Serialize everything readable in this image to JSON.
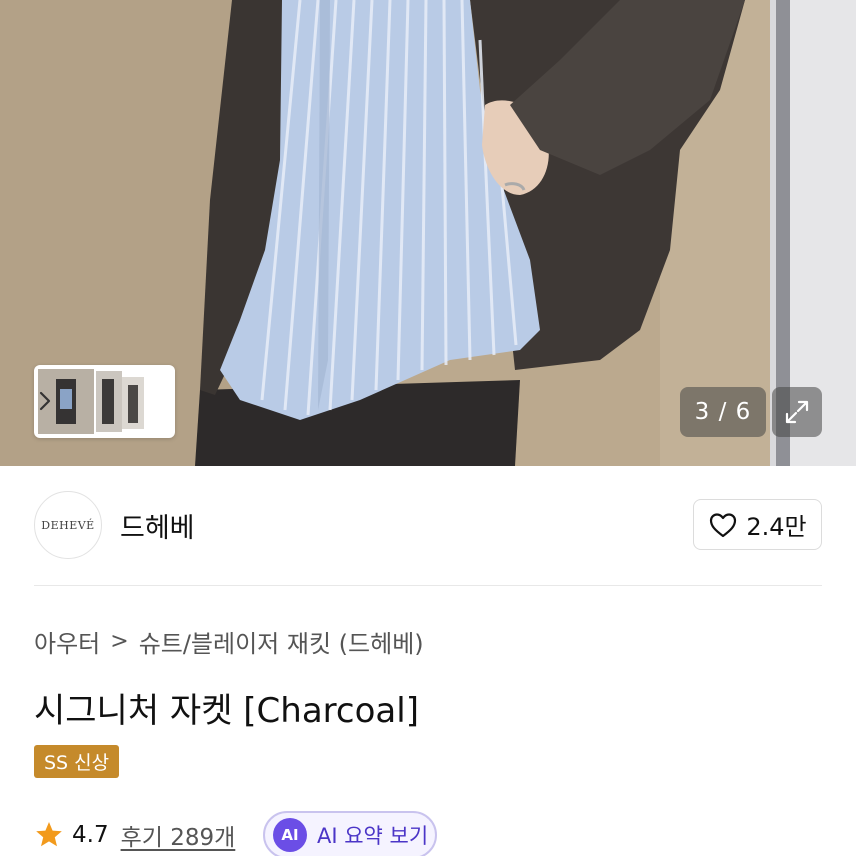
{
  "gallery": {
    "current": "3",
    "total": "6",
    "counter_text": "3 / 6",
    "icons": {
      "next": "chevron-right-icon",
      "expand": "expand-icon"
    }
  },
  "brand": {
    "logo_text": "DEHEVÉ",
    "name": "드헤베",
    "likes": "2.4만",
    "like_icon": "heart-outline-icon"
  },
  "category": {
    "parent": "아우터",
    "child": "슈트/블레이저 재킷 (드헤베)",
    "separator": ">"
  },
  "product": {
    "title": "시그니처 자켓 [Charcoal]",
    "badge": "SS 신상",
    "badge_color": "#c58a2b"
  },
  "rating": {
    "score": "4.7",
    "reviews_label": "후기 289개",
    "star_color": "#f29a1c",
    "ai_badge": "AI",
    "ai_summary_label": "AI 요약 보기",
    "ai_color": "#6b4ee6"
  }
}
